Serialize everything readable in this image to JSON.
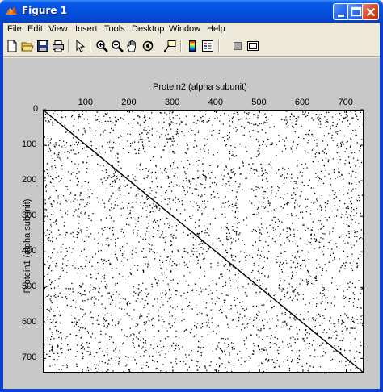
{
  "window": {
    "title": "Figure 1"
  },
  "menu": [
    "File",
    "Edit",
    "View",
    "Insert",
    "Tools",
    "Desktop",
    "Window",
    "Help"
  ],
  "toolbar": [
    "new-figure-icon",
    "open-file-icon",
    "save-icon",
    "print-icon",
    "pointer-icon",
    "zoom-in-icon",
    "zoom-out-icon",
    "pan-hand-icon",
    "rotate-3d-icon",
    "data-cursor-icon",
    "colorbar-icon",
    "legend-icon",
    "hide-plot-tools-icon",
    "show-plot-tools-icon"
  ],
  "colors": {
    "title_bar": "#0550df",
    "close_button": "#d9461e",
    "figure_bg": "#c8c8c8",
    "axes_bg": "#ffffff",
    "dots": "#000000"
  },
  "chart_data": {
    "type": "heatmap",
    "style": "binary dot plot (spy)",
    "xlabel": "Protein2 (alpha subunit)",
    "ylabel": "Protein1 (alpha subunit)",
    "x_axis_location": "top",
    "y_direction": "reversed",
    "xlim": [
      0,
      740
    ],
    "ylim": [
      0,
      740
    ],
    "xticks": [
      100,
      200,
      300,
      400,
      500,
      600,
      700
    ],
    "yticks": [
      0,
      100,
      200,
      300,
      400,
      500,
      600,
      700
    ],
    "grid": false,
    "legend": "none",
    "main_diagonal": "dense line from (0,0) to (740,740)"
  }
}
